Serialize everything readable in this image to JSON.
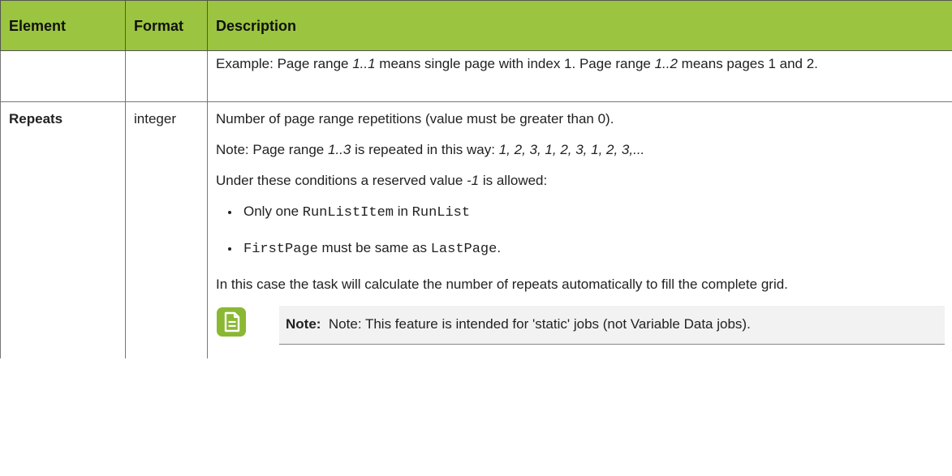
{
  "table": {
    "headers": {
      "element": "Element",
      "format": "Format",
      "description": "Description"
    },
    "row_cont": {
      "element": "",
      "format": "",
      "desc_p1": "Example: Page range ",
      "desc_i1": "1..1",
      "desc_p2": " means single page with index 1. Page range ",
      "desc_i2": "1..2",
      "desc_p3": " means pages 1 and 2."
    },
    "row_repeats": {
      "element": "Repeats",
      "format": "integer",
      "para1": "Number of page range repetitions (value must be greater than 0).",
      "para2_a": "Note: Page range ",
      "para2_i1": "1..3",
      "para2_b": " is repeated in this way: ",
      "para2_i2": "1, 2, 3, 1, 2, 3, 1, 2, 3,...",
      "para3_a": "Under these conditions a reserved value ",
      "para3_i": "-1",
      "para3_b": " is allowed:",
      "bullet1_code1": "RunListItem",
      "bullet1_pre": "Only one ",
      "bullet1_mid": " in ",
      "bullet1_code2": "RunList",
      "bullet2_code1": "FirstPage",
      "bullet2_mid": " must be same as ",
      "bullet2_code2": "LastPage",
      "bullet2_end": ".",
      "para4": "In this case the task will calculate the number of repeats automatically to fill the complete grid.",
      "note_label": "Note:",
      "note_text": "Note: This feature is intended for 'static' jobs (not Variable Data jobs)."
    }
  },
  "colors": {
    "header_bg": "#9bc440",
    "note_icon": "#8ab833",
    "note_bg": "#f2f2f2"
  },
  "icons": {
    "note": "note-document-icon"
  }
}
